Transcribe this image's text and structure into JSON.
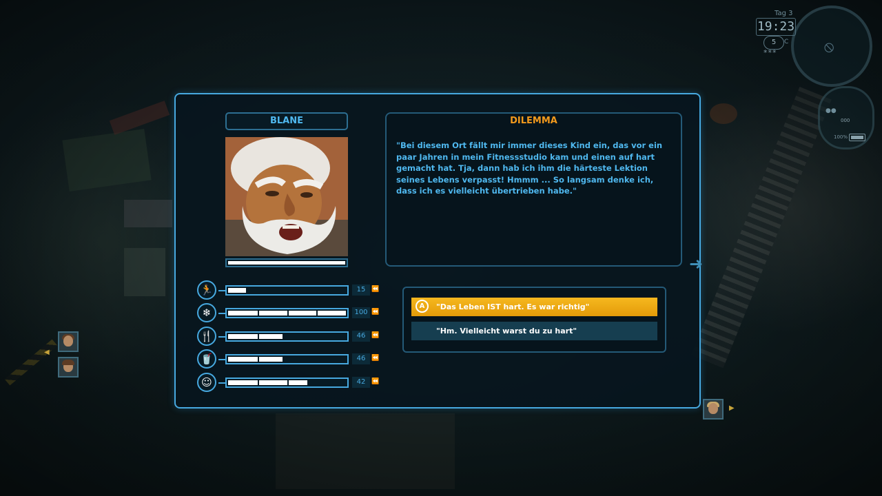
{
  "hud": {
    "day_label": "Tag 3",
    "time": "19:23",
    "weather_value": "5",
    "weather_unit": "C",
    "stars": "***",
    "signal_icon": "no-signal-icon",
    "status_dots": "●●",
    "status_counter": "000",
    "battery_label": "100%"
  },
  "character": {
    "name": "BLANE",
    "health_fraction": 1.0
  },
  "dilemma": {
    "title": "DILEMMA",
    "text": "\"Bei diesem Ort fällt mir immer dieses Kind ein, das vor ein paar Jahren in mein Fitnessstudio kam und einen auf hart gemacht hat. Tja, dann hab ich ihm die härteste Lektion seines Lebens verpasst! Hmmm ... So langsam denke ich, dass ich es vielleicht übertrieben habe.\""
  },
  "stats": [
    {
      "icon": "running-man-icon",
      "glyph": "🏃",
      "value": "15",
      "fraction": 0.15,
      "trend": "⏪"
    },
    {
      "icon": "snowflake-icon",
      "glyph": "❄",
      "value": "100",
      "fraction": 1.0,
      "trend": "⏪"
    },
    {
      "icon": "fork-knife-icon",
      "glyph": "🍴",
      "value": "46",
      "fraction": 0.46,
      "trend": "⏪"
    },
    {
      "icon": "drink-cup-icon",
      "glyph": "🥤",
      "value": "46",
      "fraction": 0.46,
      "trend": "⏪"
    },
    {
      "icon": "smiley-icon",
      "glyph": "☺",
      "value": "42",
      "fraction": 0.67,
      "trend": "⏪"
    }
  ],
  "choices": [
    {
      "button": "A",
      "label": "\"Das Leben IST hart. Es war richtig\""
    },
    {
      "label": "\"Hm. Vielleicht warst du zu hart\""
    }
  ],
  "colors": {
    "accent": "#47a9e0",
    "title_orange": "#f39a1c",
    "choice_selected": "#f0a812",
    "choice_default": "#163e50"
  }
}
